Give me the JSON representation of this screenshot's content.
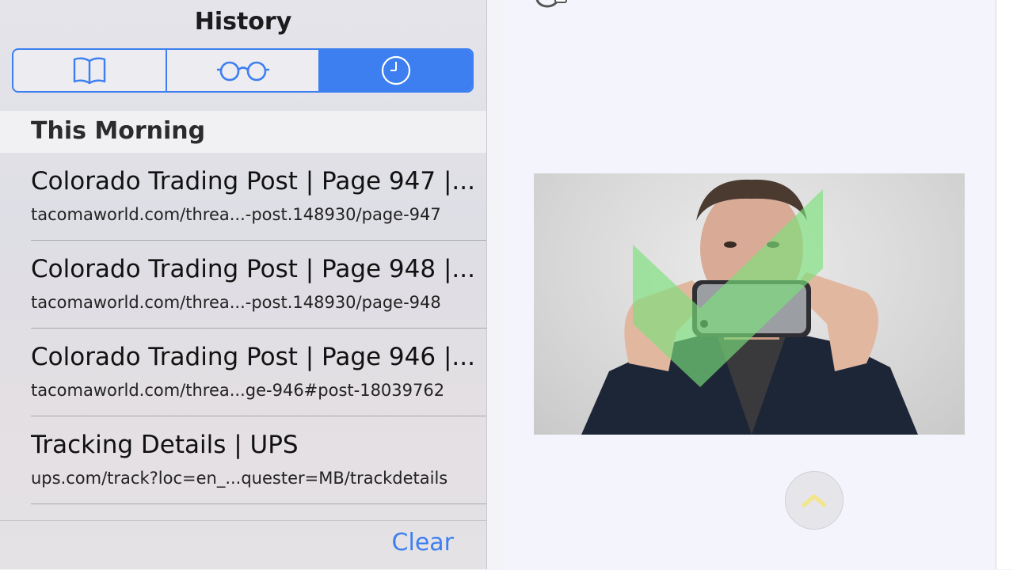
{
  "sidebar": {
    "title": "History",
    "tabs": [
      {
        "name": "bookmarks",
        "icon": "book-icon",
        "active": false
      },
      {
        "name": "reading-list",
        "icon": "glasses-icon",
        "active": false
      },
      {
        "name": "history",
        "icon": "clock-icon",
        "active": true
      }
    ],
    "section_header": "This Morning",
    "items": [
      {
        "title": "Colorado Trading Post | Page 947 |...",
        "url": "tacomaworld.com/threa...-post.148930/page-947"
      },
      {
        "title": "Colorado Trading Post | Page 948 |...",
        "url": "tacomaworld.com/threa...-post.148930/page-948"
      },
      {
        "title": "Colorado Trading Post | Page 946 |...",
        "url": "tacomaworld.com/threa...ge-946#post-18039762"
      },
      {
        "title": "Tracking Details | UPS",
        "url": "ups.com/track?loc=en_...quester=MB/trackdetails"
      }
    ],
    "clear_label": "Clear"
  },
  "colors": {
    "accent": "#3d7ff0",
    "checkmark_overlay": "#7be07b"
  },
  "main": {
    "image": {
      "subject": "man holding phone with green checkmark overlay"
    },
    "scroll_top_icon": "chevron-up-icon"
  }
}
